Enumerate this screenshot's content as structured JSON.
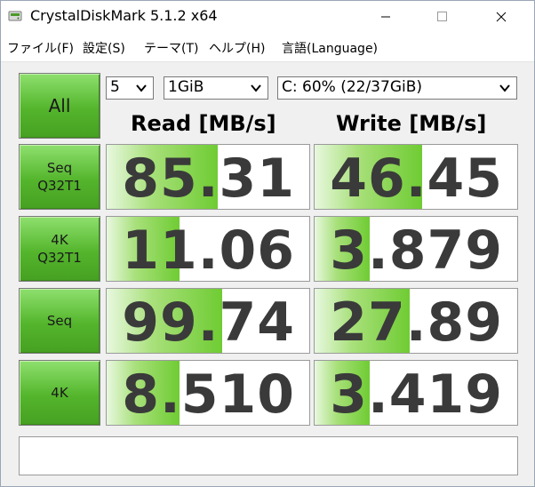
{
  "window": {
    "title": "CrystalDiskMark 5.1.2 x64"
  },
  "menu": {
    "items": [
      "ファイル(F)",
      "設定(S)",
      "テーマ(T)",
      "ヘルプ(H)",
      "言語(Language)"
    ]
  },
  "controls": {
    "all_label": "All",
    "count_value": "5",
    "size_value": "1GiB",
    "drive_value": "C: 60% (22/37GiB)"
  },
  "headers": {
    "read": "Read [MB/s]",
    "write": "Write [MB/s]"
  },
  "tests": [
    {
      "line1": "Seq",
      "line2": "Q32T1",
      "read": "85.31",
      "write": "46.45",
      "read_fill": 0.55,
      "write_fill": 0.53
    },
    {
      "line1": "4K",
      "line2": "Q32T1",
      "read": "11.06",
      "write": "3.879",
      "read_fill": 0.36,
      "write_fill": 0.27
    },
    {
      "line1": "Seq",
      "line2": "",
      "read": "99.74",
      "write": "27.89",
      "read_fill": 0.57,
      "write_fill": 0.47
    },
    {
      "line1": "4K",
      "line2": "",
      "read": "8.510",
      "write": "3.419",
      "read_fill": 0.36,
      "write_fill": 0.27
    }
  ],
  "icons": {
    "app": "crystaldiskmark-icon",
    "minimize": "minimize-icon",
    "maximize": "maximize-icon",
    "close": "close-icon",
    "dropdown": "chevron-down-icon"
  },
  "colors": {
    "accent_green": "#54b52c",
    "bar_green": "#6fcc33",
    "number_text": "#3a3a3a"
  }
}
